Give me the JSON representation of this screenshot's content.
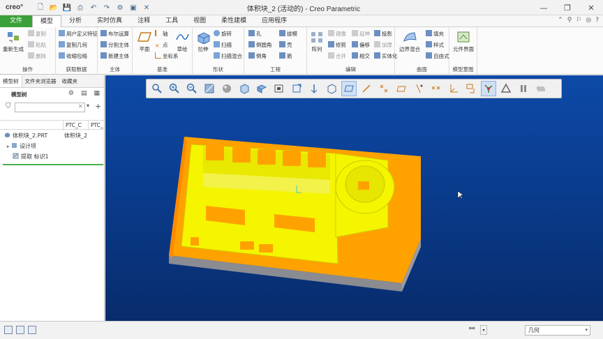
{
  "app": {
    "logo": "creo°",
    "window_title": "体积块_2 (活动的) - Creo Parametric"
  },
  "window_controls": {
    "minimize": "—",
    "restore": "❐",
    "close": "✕"
  },
  "ribbon_tabs": [
    {
      "label": "文件"
    },
    {
      "label": "模型"
    },
    {
      "label": "分析"
    },
    {
      "label": "实时仿真"
    },
    {
      "label": "注释"
    },
    {
      "label": "工具"
    },
    {
      "label": "视图"
    },
    {
      "label": "柔性建模"
    },
    {
      "label": "应用程序"
    }
  ],
  "ribbon": {
    "operations": {
      "regen": "重新生成",
      "copy": "复制",
      "paste": "粘贴",
      "delete": "删除",
      "label": "操作"
    },
    "get_data": {
      "udf": "用户定义特征",
      "copy_geom": "复制几何",
      "shrinkwrap": "收缩包络",
      "label": "获取数据"
    },
    "body": {
      "boolean": "布尔运算",
      "split": "分割主体",
      "new": "新建主体",
      "label": "主体"
    },
    "datum": {
      "plane": "平面",
      "axis": "轴",
      "point": "点",
      "csys": "坐标系",
      "sketch": "草绘",
      "label": "基准"
    },
    "shapes": {
      "extrude": "拉伸",
      "revolve": "旋转",
      "sweep": "扫描",
      "swept_blend": "扫描混合",
      "label": "形状"
    },
    "engineering": {
      "hole": "孔",
      "round": "倒圆角",
      "chamfer": "倒角",
      "draft": "拔模",
      "shell": "壳",
      "rib": "筋",
      "label": "工程"
    },
    "editing": {
      "pattern": "阵列",
      "mirror": "镜像",
      "extend": "延伸",
      "project": "投影",
      "trim": "修剪",
      "offset": "偏移",
      "thicken": "加厚",
      "merge": "合并",
      "intersect": "相交",
      "solidify": "实体化",
      "label": "编辑"
    },
    "surfaces": {
      "boundary": "边界混合",
      "fill": "填充",
      "style": "样式",
      "freeform": "自由式",
      "label": "曲面"
    },
    "model_intent": {
      "component_interface": "元件界面",
      "label": "模型意图"
    }
  },
  "left_panel": {
    "tabs": [
      "模型树",
      "文件夹浏览器",
      "收藏夹"
    ],
    "title": "模型树",
    "search_placeholder": "",
    "columns": [
      "PTC_C",
      "PTC_"
    ],
    "tree": {
      "root": "体积块_2.PRT",
      "root_value": "体积块_2",
      "design_items": "设计项",
      "extract": "提取 标识1"
    }
  },
  "status_bar": {
    "filter_value": "几何"
  },
  "colors": {
    "viewport_top": "#0d4aa8",
    "viewport_bottom": "#082c6c",
    "model_orange": "#ffa500",
    "model_yellow": "#f5f500",
    "model_base": "#9a9aa0",
    "file_tab_green": "#3aa13a"
  }
}
